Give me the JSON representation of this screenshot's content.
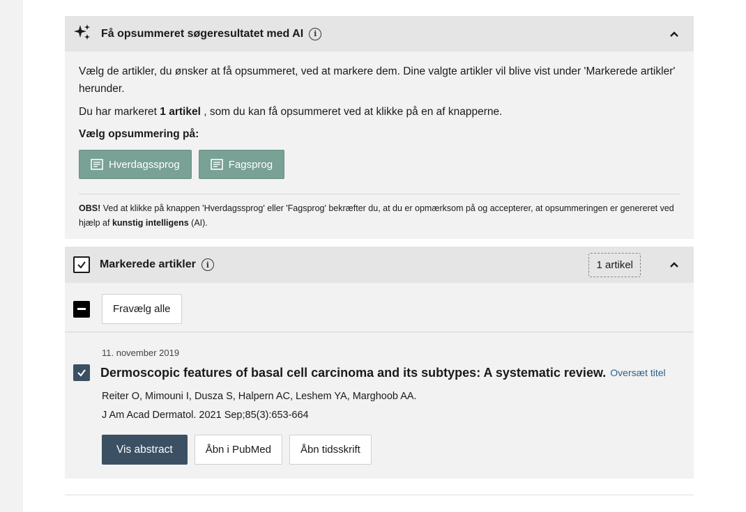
{
  "ai_panel": {
    "title": "Få opsummeret søgeresultatet med AI",
    "info_icon": "info-icon",
    "sparkle_icon": "sparkle-icon",
    "intro": "Vælg de artikler, du ønsker at få opsummeret, ved at markere dem. Dine valgte artikler vil blive vist under 'Markerede artikler' herunder.",
    "marked_prefix": "Du har markeret",
    "marked_count": "1 artikel",
    "marked_suffix": ", som du kan få opsummeret ved at klikke på en af knapperne.",
    "choose_label": "Vælg opsummering på:",
    "buttons": [
      "Hverdagssprog",
      "Fagsprog"
    ],
    "obs_bold": "OBS!",
    "obs_text": " Ved at klikke på knappen 'Hverdagssprog' eller 'Fagsprog' bekræfter du, at du er opmærksom på og accepterer, at opsummeringen er genereret ved hjælp af ",
    "obs_bold2": "kunstig intelligens",
    "obs_end": " (AI)."
  },
  "marked_panel": {
    "title": "Markerede artikler",
    "count_badge": "1 artikel",
    "deselect_all": "Fravælg alle"
  },
  "article": {
    "date": "11. november 2019",
    "title": "Dermoscopic features of basal cell carcinoma and its subtypes: A systematic review.",
    "translate_link": "Oversæt titel",
    "authors": "Reiter O, Mimouni I, Dusza S, Halpern AC, Leshem YA, Marghoob AA.",
    "journal": "J Am Acad Dermatol. 2021 Sep;85(3):653-664",
    "actions": [
      "Vis abstract",
      "Åbn i PubMed",
      "Åbn tidsskrift"
    ],
    "checked": true
  },
  "colors": {
    "green_button": "#79a195",
    "dark_button": "#3b5063",
    "link": "#2a5f8a",
    "panel_bg": "#f2f2f2",
    "header_bg": "#e5e5e5"
  }
}
